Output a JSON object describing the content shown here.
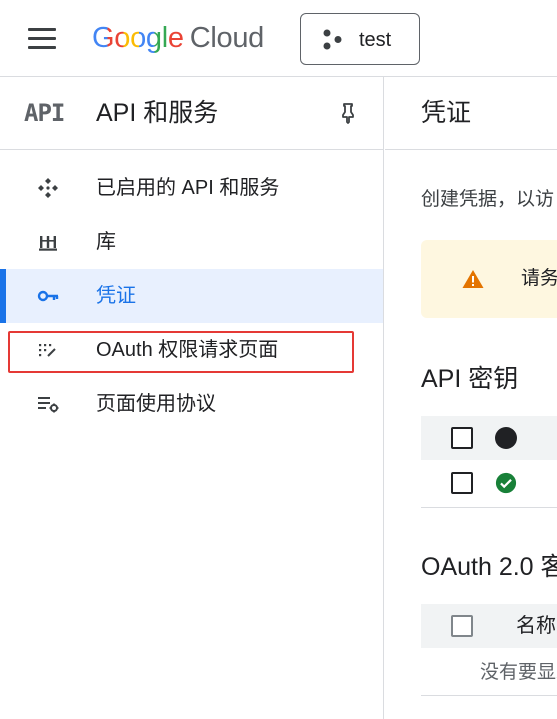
{
  "header": {
    "logo_google": "Google",
    "logo_cloud": "Cloud",
    "project_name": "test"
  },
  "sidebar": {
    "badge": "API",
    "title": "API 和服务",
    "items": [
      {
        "label": "已启用的 API 和服务",
        "icon": "api-services-icon",
        "active": false
      },
      {
        "label": "库",
        "icon": "library-icon",
        "active": false
      },
      {
        "label": "凭证",
        "icon": "key-icon",
        "active": true
      },
      {
        "label": "OAuth 权限请求页面",
        "icon": "oauth-consent-icon",
        "active": false,
        "highlighted": true
      },
      {
        "label": "页面使用协议",
        "icon": "page-agreement-icon",
        "active": false
      }
    ]
  },
  "main": {
    "title": "凭证",
    "intro": "创建凭据，以访",
    "warning": "请务",
    "api_keys_title": "API 密钥",
    "oauth_title": "OAuth 2.0 客",
    "oauth_table": {
      "name_header": "名称",
      "empty_text": "没有要显示的"
    }
  },
  "colors": {
    "accent": "#1a73e8",
    "active_bg": "#e8f0fe",
    "highlight": "#e53935",
    "warning_bg": "#fef7e0",
    "warning_icon": "#e37400",
    "success": "#188038"
  }
}
